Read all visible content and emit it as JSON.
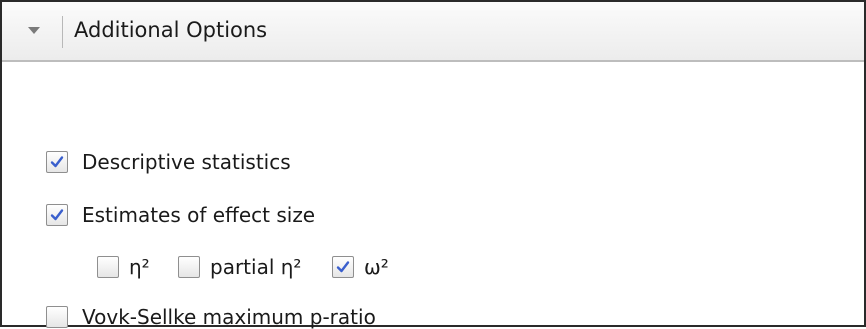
{
  "section": {
    "title": "Additional Options",
    "expanded": true
  },
  "options": {
    "descriptive_statistics": {
      "label": "Descriptive statistics",
      "checked": true
    },
    "effect_size": {
      "label": "Estimates of effect size",
      "checked": true
    },
    "eta_squared": {
      "label": "η²",
      "checked": false
    },
    "partial_eta_squared": {
      "label": "partial η²",
      "checked": false
    },
    "omega_squared": {
      "label": "ω²",
      "checked": true
    },
    "vovk_sellke": {
      "label": "Vovk-Sellke maximum p-ratio",
      "checked": false
    }
  },
  "colors": {
    "check_mark": "#3a5fcd",
    "border": "#8f8f8f",
    "header_bg": "#ececec"
  }
}
